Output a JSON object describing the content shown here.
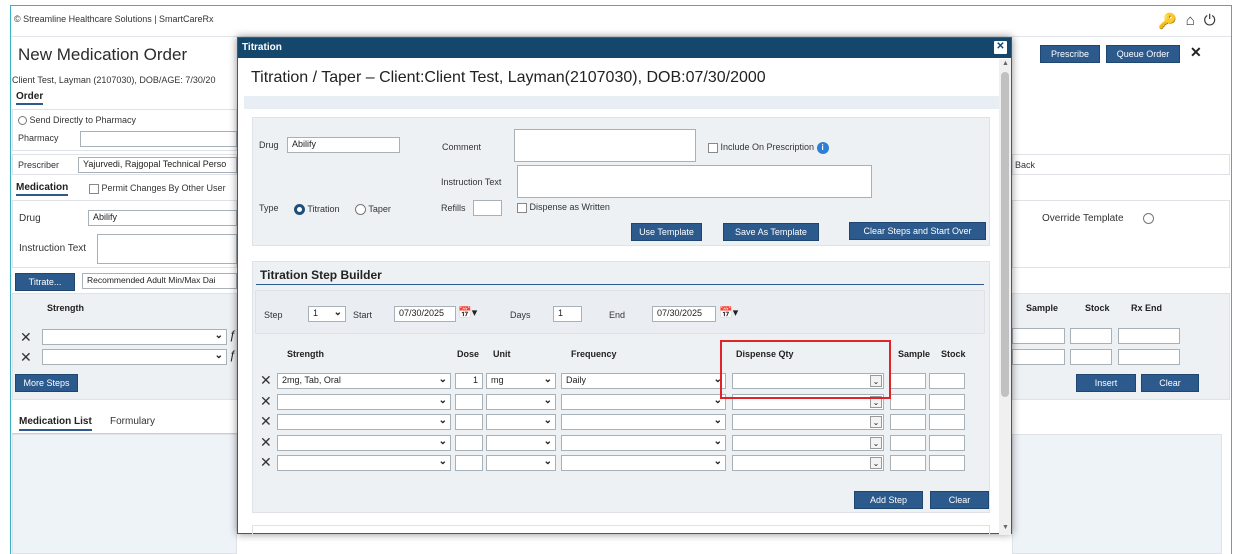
{
  "app": {
    "brand": "© Streamline Healthcare Solutions | SmartCareRx",
    "page_title": "New Medication Order",
    "prescribe": "Prescribe",
    "queue_order": "Queue Order",
    "close": "✕",
    "client_line": "Client Test, Layman (2107030), DOB/AGE: 7/30/20"
  },
  "bg": {
    "order_tab": "Order",
    "send_pharmacy": "Send Directly to Pharmacy",
    "pharmacy_label": "Pharmacy",
    "prescriber_label": "Prescriber",
    "prescriber_value": "Yajurvedi, Rajgopal Technical Perso",
    "back": "Back",
    "medication_tab": "Medication",
    "permit_changes": "Permit Changes By Other User",
    "drug_label": "Drug",
    "drug_value": "Abilify",
    "override_template": "Override Template",
    "instruction_label": "Instruction Text",
    "titrate_btn": "Titrate...",
    "recommended": "Recommended Adult Min/Max Dai",
    "strength_hdr": "Strength",
    "sample_hdr": "Sample",
    "stock_hdr": "Stock",
    "rx_end_hdr": "Rx End",
    "more_steps": "More Steps",
    "insert": "Insert",
    "clear": "Clear",
    "tab_med_list": "Medication List",
    "tab_formulary": "Formulary"
  },
  "modal": {
    "header": "Titration",
    "title": "Titration / Taper – Client:Client Test, Layman(2107030), DOB:07/30/2000",
    "drug_label": "Drug",
    "drug_value": "Abilify",
    "comment_label": "Comment",
    "include_rx": "Include On Prescription",
    "instruction_label": "Instruction Text",
    "type_label": "Type",
    "titration": "Titration",
    "taper": "Taper",
    "refills_label": "Refills",
    "daw": "Dispense as Written",
    "use_template": "Use Template",
    "save_template": "Save As Template",
    "clear_steps": "Clear Steps and Start Over",
    "builder_title": "Titration Step Builder",
    "step_label": "Step",
    "step_value": "1",
    "start_label": "Start",
    "start_value": "07/30/2025",
    "days_label": "Days",
    "days_value": "1",
    "end_label": "End",
    "end_value": "07/30/2025",
    "cols": {
      "strength": "Strength",
      "dose": "Dose",
      "unit": "Unit",
      "frequency": "Frequency",
      "dispense": "Dispense Qty",
      "sample": "Sample",
      "stock": "Stock"
    },
    "rows": [
      {
        "strength": "2mg, Tab, Oral",
        "dose": "1",
        "unit": "mg",
        "frequency": "Daily"
      },
      {
        "strength": "",
        "dose": "",
        "unit": "",
        "frequency": ""
      },
      {
        "strength": "",
        "dose": "",
        "unit": "",
        "frequency": ""
      },
      {
        "strength": "",
        "dose": "",
        "unit": "",
        "frequency": ""
      },
      {
        "strength": "",
        "dose": "",
        "unit": "",
        "frequency": ""
      }
    ],
    "add_step": "Add Step",
    "clear": "Clear"
  }
}
